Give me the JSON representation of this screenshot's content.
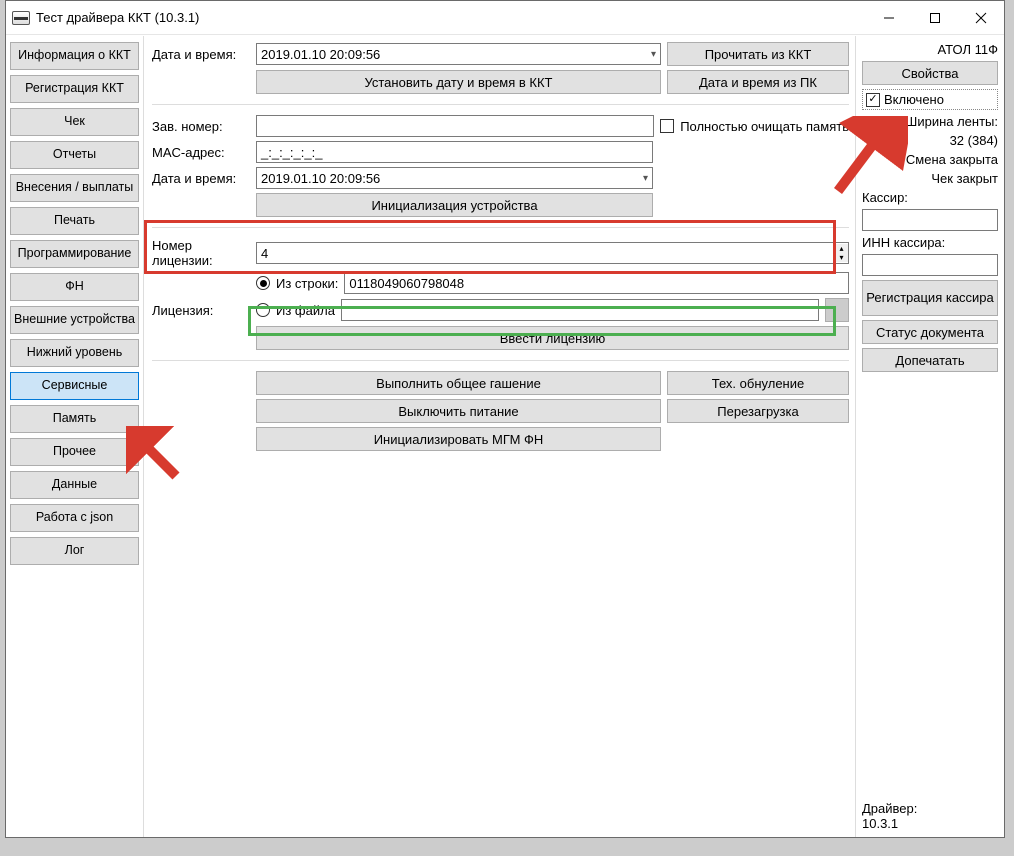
{
  "window": {
    "title": "Тест драйвера ККТ (10.3.1)"
  },
  "sidebar": {
    "items": [
      "Информация о ККТ",
      "Регистрация ККТ",
      "Чек",
      "Отчеты",
      "Внесения / выплаты",
      "Печать",
      "Программирование",
      "ФН",
      "Внешние устройства",
      "Нижний уровень",
      "Сервисные",
      "Память",
      "Прочее",
      "Данные",
      "Работа с json",
      "Лог"
    ],
    "active_index": 10
  },
  "main": {
    "labels": {
      "datetime": "Дата и время:",
      "serial": "Зав. номер:",
      "mac": "MAC-адрес:",
      "datetime2": "Дата и время:",
      "license_num": "Номер лицензии:",
      "license": "Лицензия:",
      "from_string": "Из строки:",
      "from_file": "Из файла",
      "clear_mem": "Полностью очищать память"
    },
    "values": {
      "datetime": "2019.01.10 20:09:56",
      "serial": "",
      "mac": "_:_:_:_:_:_",
      "datetime2": "2019.01.10 20:09:56",
      "license_num": "4",
      "license_string": "0118049060798048",
      "file_path": ""
    },
    "buttons": {
      "read_from_kkt": "Прочитать из ККТ",
      "datetime_from_pc": "Дата и время из ПК",
      "set_datetime": "Установить дату и время в ККТ",
      "init_device": "Инициализация устройства",
      "enter_license": "Ввести лицензию",
      "full_erase": "Выполнить общее гашение",
      "tech_reset": "Тех. обнуление",
      "power_off": "Выключить питание",
      "reboot": "Перезагрузка",
      "init_mgm": "Инициализировать МГМ ФН"
    }
  },
  "right": {
    "device": "АТОЛ 11Ф",
    "properties_btn": "Свойства",
    "enabled_chk": "Включено",
    "tape_width_lbl": "Ширина ленты:",
    "tape_width_val": "32 (384)",
    "shift_status": "Смена закрыта",
    "check_status": "Чек закрыт",
    "cashier_lbl": "Кассир:",
    "cashier_inn_lbl": "ИНН кассира:",
    "reg_cashier_btn": "Регистрация кассира",
    "doc_status_btn": "Статус документа",
    "print_more_btn": "Допечатать",
    "driver_lbl": "Драйвер:",
    "driver_ver": "10.3.1"
  }
}
